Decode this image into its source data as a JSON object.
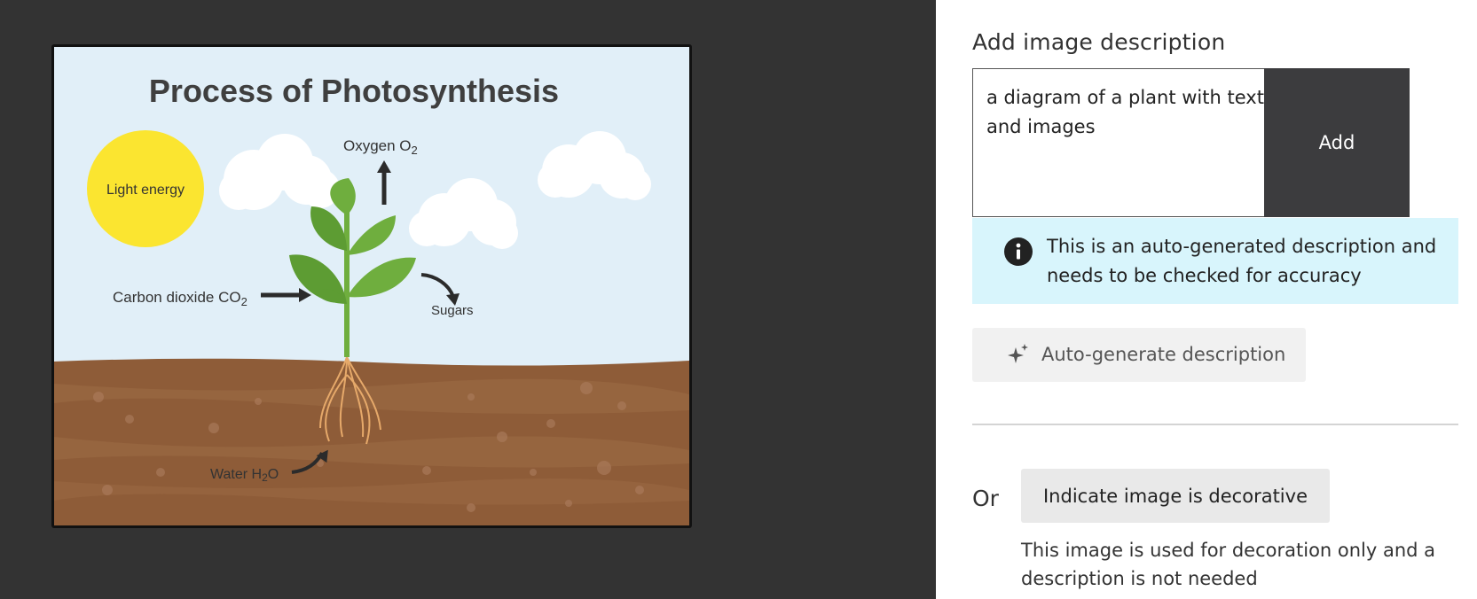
{
  "image": {
    "title": "Process of Photosynthesis",
    "labels": {
      "light": "Light energy",
      "oxygen": "Oxygen O",
      "oxygen_sub": "2",
      "co2": "Carbon dioxide CO",
      "co2_sub": "2",
      "sugars": "Sugars",
      "water": "Water H",
      "water_sub": "2",
      "water_tail": "O"
    }
  },
  "panel": {
    "heading": "Add image description",
    "description_value": "a diagram of a plant with text and images",
    "add_label": "Add",
    "info_text": "This is an auto-generated description and needs to be checked for accuracy",
    "auto_generate_label": "Auto-generate description",
    "or_label": "Or",
    "decorative_label": "Indicate image is decorative",
    "decorative_note": "This image is used for decoration only and a description is not needed"
  },
  "icons": {
    "info": "info-icon",
    "sparkle": "sparkle-icon"
  },
  "colors": {
    "left_background": "#333333",
    "add_button": "#3c3c3e",
    "info_background": "#d8f5fc",
    "sun": "#fbe530",
    "sky": "#e1eff8",
    "soil": "#8e5c38",
    "leaf": "#6fae3e"
  }
}
